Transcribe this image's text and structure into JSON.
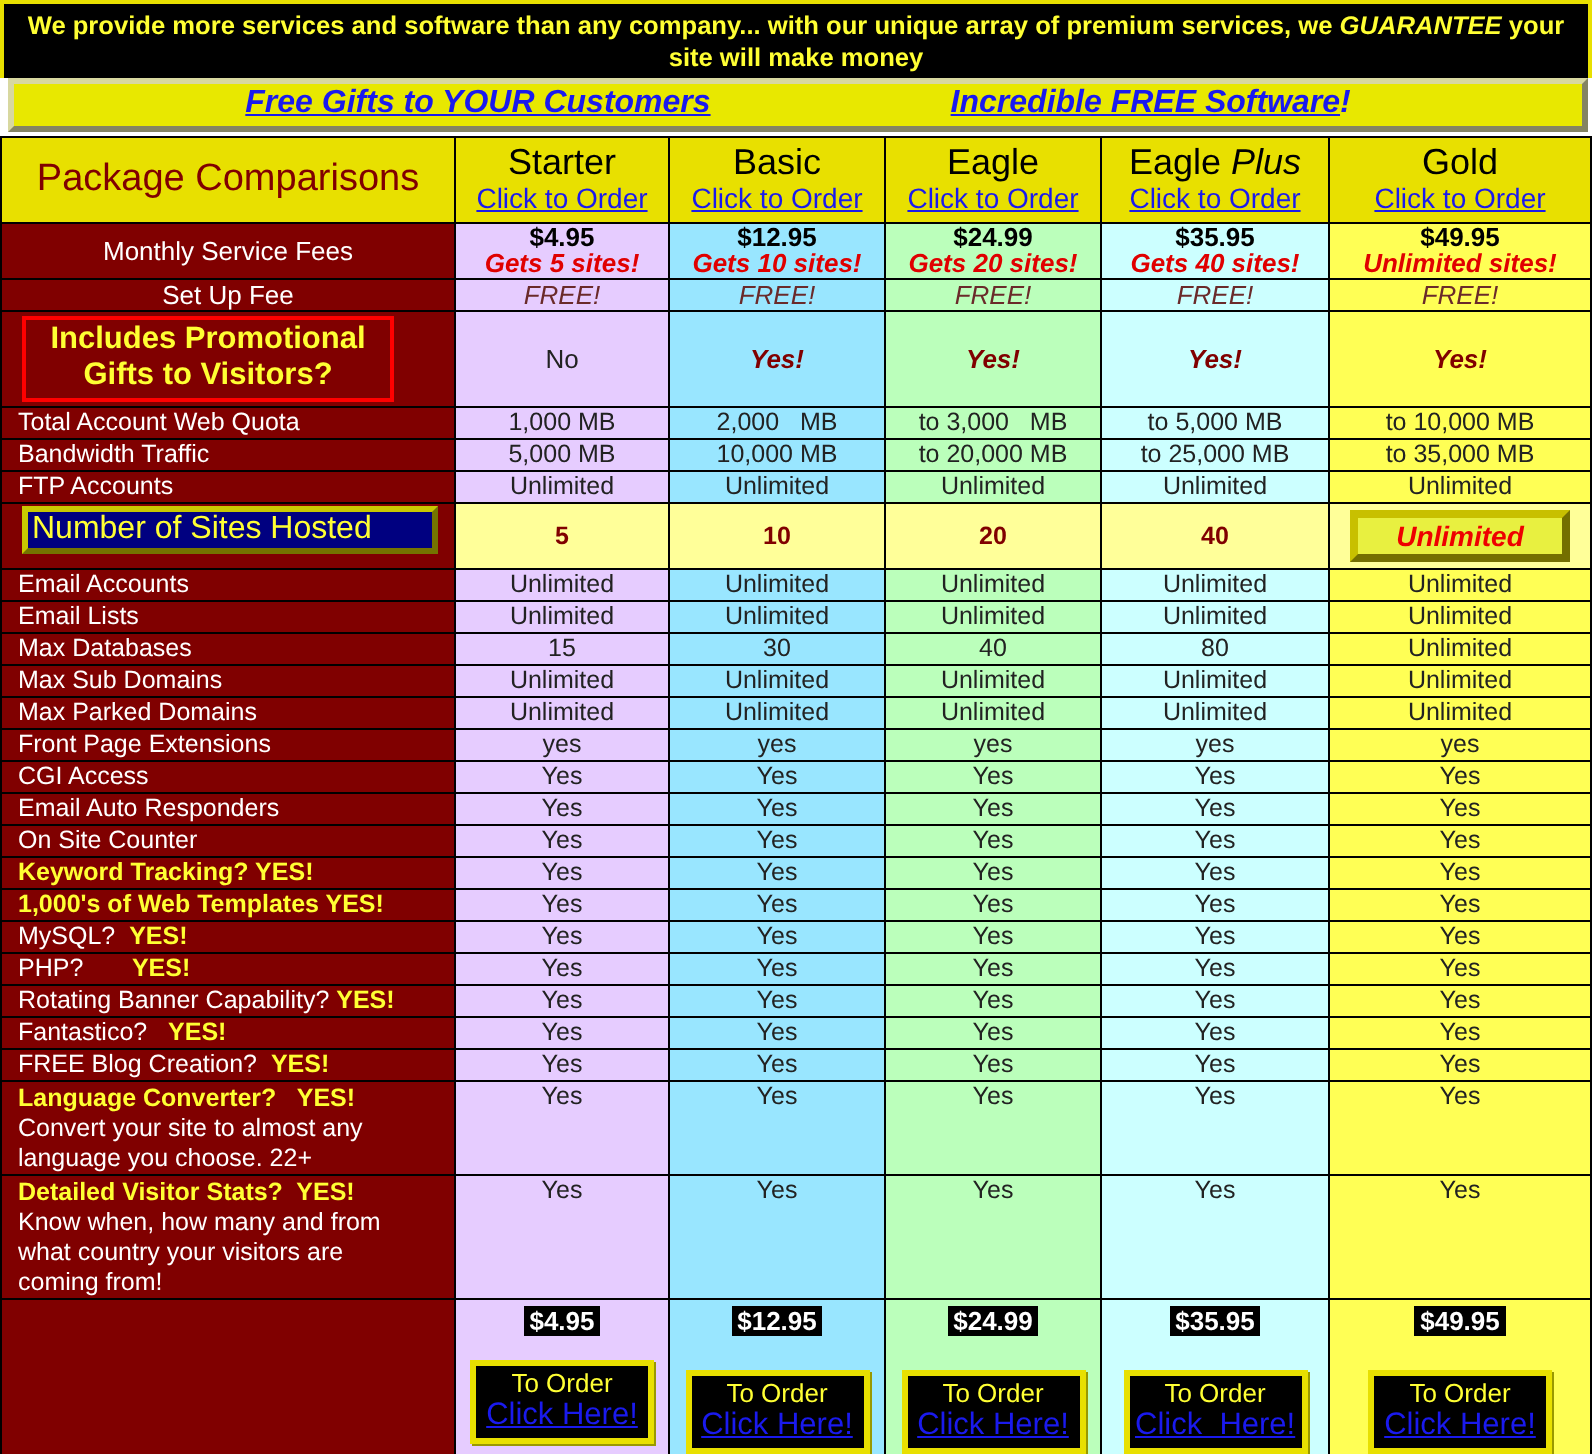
{
  "banner": {
    "text": "We provide more services and software than any company... with our unique array of premium services, we *GUARANTEE* your site will make money"
  },
  "links": [
    {
      "label": "Free Gifts to YOUR Customers"
    },
    {
      "label": "Incredible FREE Software",
      "trail": "!"
    }
  ],
  "table": {
    "title": "Package Comparisons",
    "plans": [
      {
        "name": "Starter",
        "order": "Click to Order",
        "color": "#e6ccff",
        "price": "$4.95",
        "button_label": "To Order",
        "button_link": "Click Here!"
      },
      {
        "name": "Basic",
        "order": "Click to Order",
        "color": "#99e6ff",
        "price": "$12.95",
        "button_label": "To Order",
        "button_link": "Click Here!"
      },
      {
        "name": "Eagle",
        "order": "Click to Order",
        "color": "#bbffbb",
        "price": "$24.99",
        "button_label": "To Order",
        "button_link": "Click Here!"
      },
      {
        "name": "Eagle *Plus*",
        "order": "Click to Order ",
        "color": "#ccffff",
        "price": "$35.95",
        "button_label": "To Order",
        "button_link": "Click  Here!"
      },
      {
        "name": "Gold",
        "order": "Click to Order",
        "color": "#ffff55",
        "price": "$49.95",
        "button_label": "To Order",
        "button_link": "Click Here!"
      }
    ],
    "rows": [
      {
        "kind": "fee",
        "label": "Monthly Service Fees",
        "values": [
          {
            "price": "$4.95",
            "note": "Gets 5 sites!"
          },
          {
            "price": "$12.95",
            "note": "Gets 10 sites!"
          },
          {
            "price": "$24.99",
            "note": "Gets 20 sites!"
          },
          {
            "price": "$35.95",
            "note": "Gets 40 sites!"
          },
          {
            "price": "$49.95",
            "note": "Unlimited sites!"
          }
        ]
      },
      {
        "kind": "setup",
        "label": "Set Up Fee",
        "values": [
          "FREE!",
          "FREE!",
          "FREE!",
          "FREE!",
          "FREE!"
        ]
      },
      {
        "kind": "promo",
        "label": "Includes Promotional Gifts to Visitors?",
        "values": [
          {
            "text": "No",
            "emphasized": false
          },
          {
            "text": "Yes!",
            "emphasized": true
          },
          {
            "text": "Yes!",
            "emphasized": true
          },
          {
            "text": "Yes!",
            "emphasized": true
          },
          {
            "text": "Yes!",
            "emphasized": true
          }
        ]
      },
      {
        "kind": "plain",
        "label": "Total Account Web Quota",
        "values": [
          "1,000 MB",
          "2,000   MB",
          "to 3,000   MB",
          "to 5,000 MB",
          "to 10,000 MB"
        ]
      },
      {
        "kind": "plain",
        "label": "Bandwidth Traffic",
        "values": [
          "5,000 MB",
          "10,000 MB",
          "to 20,000 MB",
          "to 25,000 MB",
          "to 35,000 MB"
        ]
      },
      {
        "kind": "plain",
        "label": "FTP Accounts",
        "values": [
          "Unlimited",
          "Unlimited",
          "Unlimited",
          "Unlimited",
          "Unlimited"
        ]
      },
      {
        "kind": "sites",
        "label": "Number of Sites Hosted",
        "values": [
          {
            "text": "5",
            "kind": "number"
          },
          {
            "text": "10",
            "kind": "number"
          },
          {
            "text": "20",
            "kind": "number"
          },
          {
            "text": "40",
            "kind": "number"
          },
          {
            "text": "Unlimited",
            "kind": "badge"
          }
        ]
      },
      {
        "kind": "plain",
        "label": "Email Accounts",
        "values": [
          "Unlimited",
          "Unlimited",
          "Unlimited",
          "Unlimited",
          "Unlimited"
        ]
      },
      {
        "kind": "plain",
        "label": "Email Lists",
        "values": [
          "Unlimited",
          "Unlimited",
          "Unlimited",
          "Unlimited",
          "Unlimited"
        ]
      },
      {
        "kind": "plain",
        "label": "Max Databases",
        "values": [
          "15",
          "30",
          "40",
          "80",
          "Unlimited"
        ]
      },
      {
        "kind": "plain",
        "label": "Max Sub Domains",
        "values": [
          "Unlimited",
          "Unlimited",
          "Unlimited",
          "Unlimited",
          "Unlimited"
        ]
      },
      {
        "kind": "plain",
        "label": "Max Parked Domains",
        "values": [
          "Unlimited",
          "Unlimited",
          "Unlimited",
          "Unlimited",
          "Unlimited"
        ]
      },
      {
        "kind": "plain",
        "label": "Front Page Extensions",
        "values": [
          "yes",
          "yes",
          "yes",
          "yes",
          "yes"
        ]
      },
      {
        "kind": "plain",
        "label": "CGI Access",
        "values": [
          "Yes",
          "Yes",
          "Yes",
          "Yes",
          "Yes"
        ]
      },
      {
        "kind": "plain",
        "label": "Email Auto Responders",
        "values": [
          "Yes",
          "Yes",
          "Yes",
          "Yes",
          "Yes"
        ]
      },
      {
        "kind": "plain",
        "label": "On Site Counter",
        "values": [
          "Yes",
          "Yes",
          "Yes",
          "Yes",
          "Yes"
        ]
      },
      {
        "kind": "highlight",
        "label": "Keyword Tracking? YES!",
        "values": [
          "Yes",
          "Yes",
          "Yes",
          "Yes",
          "Yes"
        ]
      },
      {
        "kind": "highlight",
        "label": "1,000's of Web Templates YES!",
        "values": [
          "Yes",
          "Yes",
          "Yes",
          "Yes",
          "Yes"
        ]
      },
      {
        "kind": "plain",
        "label": "MySQL?  **YES!**",
        "values": [
          "Yes",
          "Yes",
          "Yes",
          "Yes",
          "Yes"
        ]
      },
      {
        "kind": "plain",
        "label": "PHP?       **YES!**",
        "values": [
          "Yes",
          "Yes",
          "Yes",
          "Yes",
          "Yes"
        ]
      },
      {
        "kind": "plain",
        "label": "Rotating Banner Capability? **YES!**",
        "values": [
          "Yes",
          "Yes",
          "Yes",
          "Yes",
          "Yes"
        ]
      },
      {
        "kind": "plain",
        "label": "Fantastico?   **YES!**",
        "values": [
          "Yes",
          "Yes",
          "Yes",
          "Yes",
          "Yes"
        ]
      },
      {
        "kind": "plain",
        "label": "FREE Blog Creation?  **YES!**",
        "values": [
          "Yes",
          "Yes",
          "Yes",
          "Yes",
          "Yes"
        ]
      },
      {
        "kind": "described",
        "label": "Language Converter?   YES!",
        "description": "Convert your site to almost any language you choose.  22+",
        "values": [
          "Yes",
          "Yes",
          "Yes",
          "Yes",
          "Yes"
        ]
      },
      {
        "kind": "described",
        "label": "Detailed Visitor Stats?  YES!",
        "description": "Know when, how many and from what country your visitors are coming from!",
        "values": [
          "Yes",
          "Yes",
          "Yes",
          "Yes",
          "Yes"
        ]
      }
    ]
  }
}
